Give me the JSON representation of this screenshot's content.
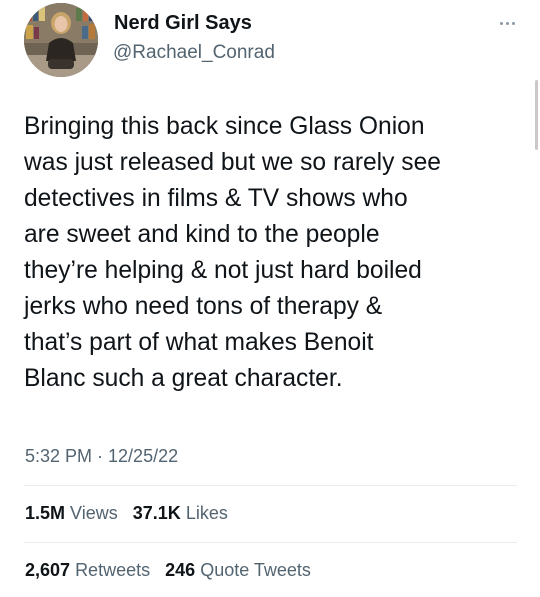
{
  "author": {
    "name": "Nerd Girl Says",
    "handle": "@Rachael_Conrad"
  },
  "tweet": {
    "text_lines": [
      "Bringing this back since Glass Onion",
      "was just released but we so rarely see",
      "detectives in films & TV shows who",
      "are sweet and kind to the people",
      "they’re helping & not just hard boiled",
      "jerks who need tons of therapy &",
      "that’s part of what makes Benoit",
      "Blanc such a great character."
    ],
    "timestamp": "5:32 PM · 12/25/22"
  },
  "stats": {
    "views": {
      "count": "1.5M",
      "label": "Views"
    },
    "likes": {
      "count": "37.1K",
      "label": "Likes"
    },
    "retweets": {
      "count": "2,607",
      "label": "Retweets"
    },
    "quote_tweets": {
      "count": "246",
      "label": "Quote Tweets"
    }
  },
  "icons": {
    "more": "more-horizontal-icon"
  },
  "colors": {
    "text_primary": "#0f1419",
    "text_secondary": "#536471",
    "divider": "#e6ecf0"
  }
}
